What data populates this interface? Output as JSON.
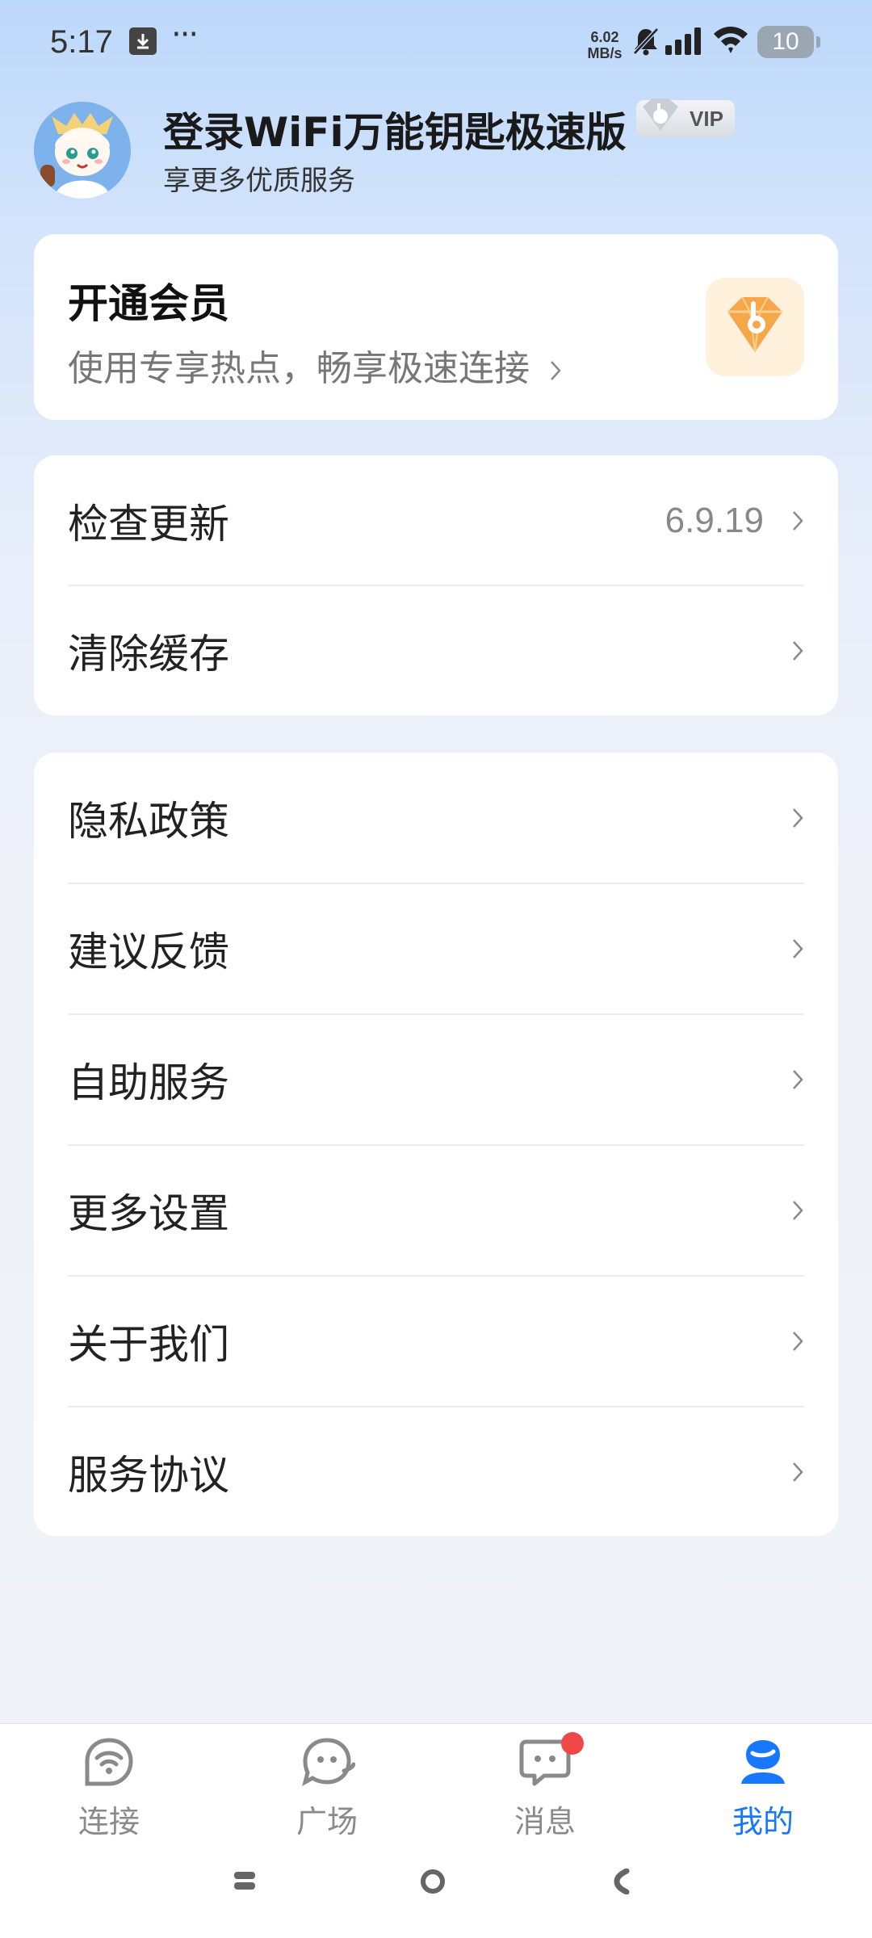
{
  "status_bar": {
    "time": "5:17",
    "more": "···",
    "net_speed_value": "6.02",
    "net_speed_unit": "MB/s",
    "battery": "10",
    "icons": [
      "download-icon",
      "bell-muted-icon",
      "signal-icon",
      "wifi-icon",
      "battery-icon"
    ]
  },
  "profile": {
    "title": "登录WiFi万能钥匙极速版",
    "vip_badge": "VIP",
    "subtitle": "享更多优质服务"
  },
  "member": {
    "title": "开通会员",
    "subtitle": "使用专享热点，畅享极速连接",
    "icon": "diamond-key-icon"
  },
  "update_card": {
    "rows": [
      {
        "label": "检查更新",
        "value": "6.9.19"
      },
      {
        "label": "清除缓存"
      }
    ]
  },
  "settings_card": {
    "rows": [
      {
        "label": "隐私政策"
      },
      {
        "label": "建议反馈"
      },
      {
        "label": "自助服务"
      },
      {
        "label": "更多设置"
      },
      {
        "label": "关于我们"
      },
      {
        "label": "服务协议"
      }
    ]
  },
  "bottom_nav": {
    "items": [
      {
        "label": "连接",
        "icon": "wifi-connect-icon",
        "active": false
      },
      {
        "label": "广场",
        "icon": "chat-face-icon",
        "active": false
      },
      {
        "label": "消息",
        "icon": "message-icon",
        "active": false,
        "badge": true
      },
      {
        "label": "我的",
        "icon": "profile-icon",
        "active": true
      }
    ]
  },
  "colors": {
    "accent": "#1677ff",
    "badge_red": "#f04848",
    "member_icon_bg": "#fff1dc",
    "member_icon": "#f5a74a"
  }
}
